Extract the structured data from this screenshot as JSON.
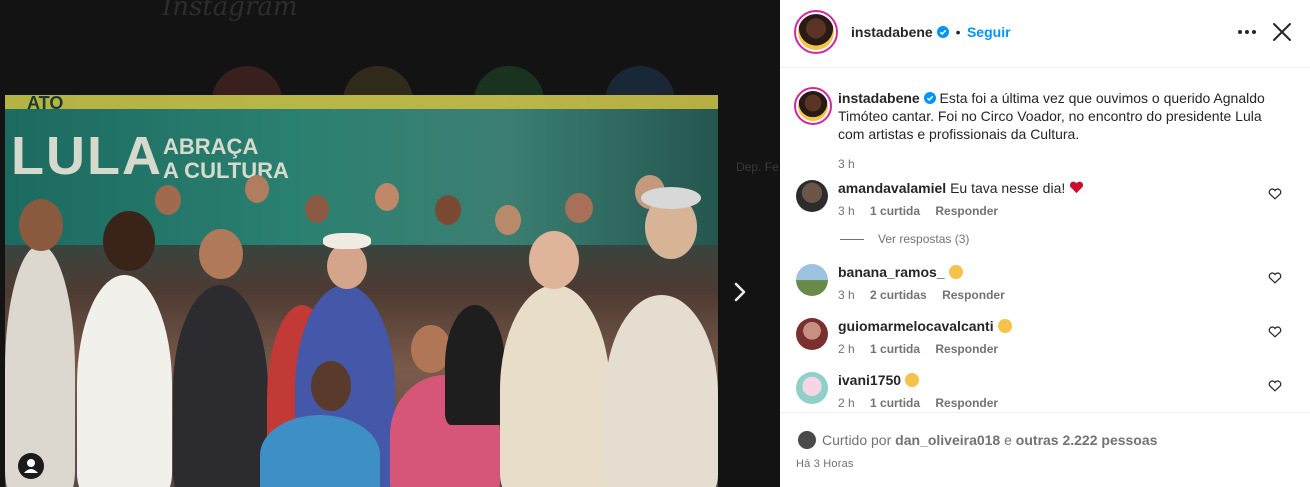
{
  "background": {
    "logo": "Instagram",
    "story_label": "Dep. Fe"
  },
  "post": {
    "author": "instadabene",
    "follow_label": "Seguir",
    "separator": "•",
    "caption": "Esta foi a última vez que ouvimos o querido Agnaldo Timóteo cantar. Foi no Circo Voador, no encontro do presidente Lula com artistas e profissionais da Cultura.",
    "caption_time": "3 h",
    "photo_text": {
      "ato": "ATO",
      "lula": "LULA",
      "abraca_line1": "ABRAÇA",
      "abraca_line2": "A CULTURA"
    }
  },
  "comments": [
    {
      "user": "amandavalamiel",
      "text": "Eu tava nesse dia!",
      "emoji": "red-heart",
      "time": "3 h",
      "likes": "1 curtida",
      "reply": "Responder"
    },
    {
      "user": "banana_ramos_",
      "text": "",
      "emoji": "sad-face",
      "time": "3 h",
      "likes": "2 curtidas",
      "reply": "Responder"
    },
    {
      "user": "guiomarmelocavalcanti",
      "text": "",
      "emoji": "sad-face",
      "time": "2 h",
      "likes": "1 curtida",
      "reply": "Responder"
    },
    {
      "user": "ivani1750",
      "text": "",
      "emoji": "sad-face",
      "time": "2 h",
      "likes": "1 curtida",
      "reply": "Responder"
    }
  ],
  "view_replies": "Ver respostas (3)",
  "likes_summary": {
    "prefix": "Curtido por",
    "user": "dan_oliveira018",
    "middle": "e",
    "others": "outras 2.222 pessoas"
  },
  "posted_ago": "Há 3 Horas",
  "colors": {
    "accent": "#0095f6",
    "heart": "#ed4956",
    "text": "#262626",
    "secondary": "#737373"
  }
}
